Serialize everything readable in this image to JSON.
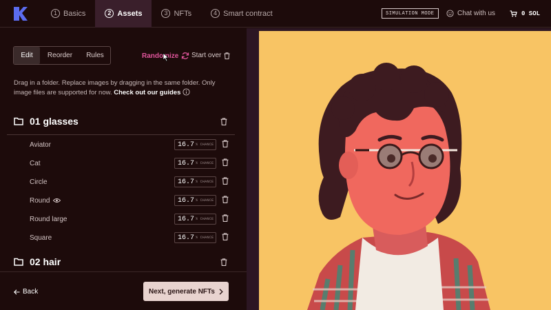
{
  "nav": {
    "steps": [
      {
        "num": "1",
        "label": "Basics"
      },
      {
        "num": "2",
        "label": "Assets"
      },
      {
        "num": "3",
        "label": "NFTs"
      },
      {
        "num": "4",
        "label": "Smart contract"
      }
    ],
    "active_step": 1,
    "sim_badge": "SIMULATION MODE",
    "chat_label": "Chat with us",
    "cart_label": "0 SOL"
  },
  "editor": {
    "tabs": [
      "Edit",
      "Reorder",
      "Rules"
    ],
    "active_tab": 0,
    "randomize_label": "Randomize",
    "startover_label": "Start over",
    "help_text": "Drag in a folder. Replace images by dragging in the same folder. Only image files are supported for now.",
    "help_link": "Check out our guides"
  },
  "folders": [
    {
      "name": "01 glasses",
      "items": [
        {
          "name": "Aviator",
          "chance": "16.7"
        },
        {
          "name": "Cat",
          "chance": "16.7"
        },
        {
          "name": "Circle",
          "chance": "16.7"
        },
        {
          "name": "Round",
          "chance": "16.7",
          "icon": "eye-icon"
        },
        {
          "name": "Round large",
          "chance": "16.7"
        },
        {
          "name": "Square",
          "chance": "16.7"
        }
      ]
    },
    {
      "name": "02 hair",
      "items": []
    }
  ],
  "chance_unit": "% CHANCE",
  "footer": {
    "back_label": "Back",
    "next_label": "Next, generate NFTs"
  },
  "colors": {
    "accent": "#e0559b",
    "preview_bg": "#f8c464",
    "panel_bg": "#1d0b0b"
  }
}
